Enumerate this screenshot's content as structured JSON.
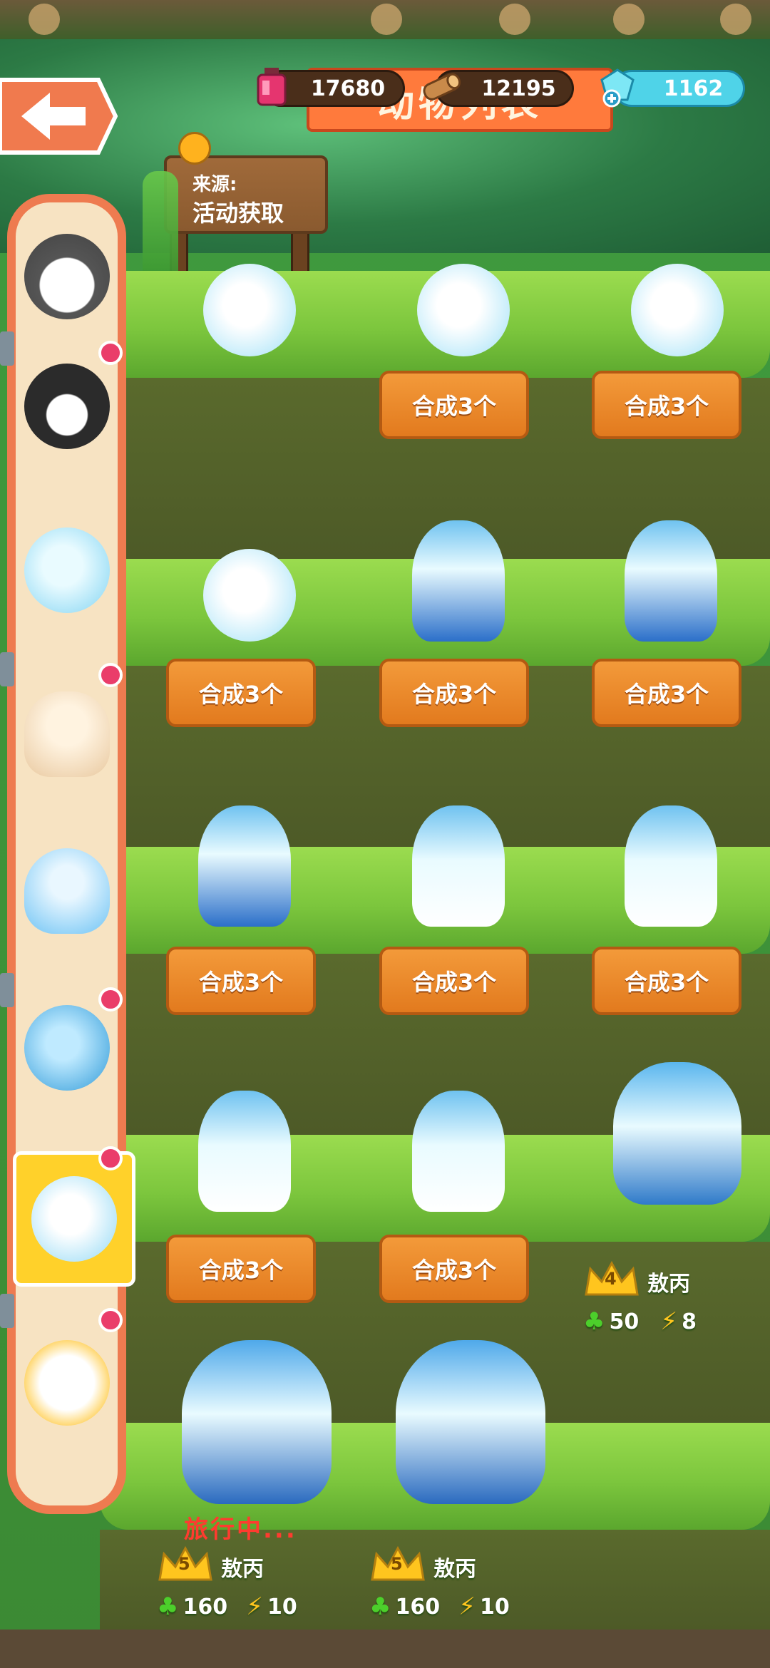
{
  "resources": {
    "ink": "17680",
    "wood": "12195",
    "gems": "1162"
  },
  "title": "动物列表",
  "source": {
    "label": "来源:",
    "value": "活动获取"
  },
  "merge_label": "合成3个",
  "creature_name": "敖丙",
  "travel_status": "旅行中...",
  "stat_items": [
    {
      "level": "4",
      "clover": "50",
      "energy": "8"
    },
    {
      "level": "5",
      "clover": "160",
      "energy": "10"
    },
    {
      "level": "5",
      "clover": "160",
      "energy": "10"
    }
  ],
  "sidebar_animals": [
    "husky",
    "skunk",
    "bunny-ball",
    "seashell",
    "jellyfish",
    "blue-seal",
    "dragon-ball",
    "bird"
  ],
  "colors": {
    "accent_orange": "#e27a1e",
    "sidebar_border": "#ee7b50",
    "active_tab": "#ffd12a",
    "notify_dot": "#ea3d6a",
    "travel_text": "#ff3b2f"
  }
}
